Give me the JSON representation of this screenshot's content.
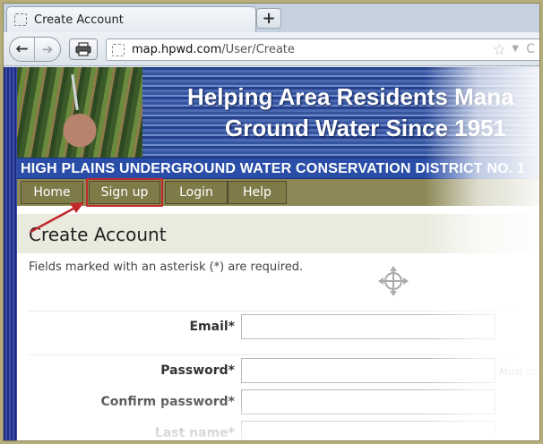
{
  "browser": {
    "tab_title": "Create Account",
    "new_tab_label": "+",
    "url_host": "map.hpwd.com",
    "url_path": "/User/Create",
    "url_prefix": ""
  },
  "banner": {
    "line1": "Helping Area Residents Mana",
    "line2": "Ground Water Since 1951",
    "district": "HIGH PLAINS UNDERGROUND WATER CONSERVATION DISTRICT NO. 1"
  },
  "menu": {
    "items": [
      {
        "label": "Home"
      },
      {
        "label": "Sign up"
      },
      {
        "label": "Login"
      },
      {
        "label": "Help"
      }
    ]
  },
  "main": {
    "title": "Create Account",
    "required_note": "Fields marked with an asterisk (*) are required.",
    "fields": [
      {
        "label": "Email*",
        "value": "",
        "hint": ""
      },
      {
        "label": "Password*",
        "value": "",
        "hint": "Must co"
      },
      {
        "label": "Confirm password*",
        "value": "",
        "hint": ""
      },
      {
        "label": "Last name*",
        "value": "",
        "hint": ""
      }
    ]
  },
  "colors": {
    "menu_bg": "#8d8957",
    "highlight": "#c0282a",
    "district_bar": "#2a4ea8"
  }
}
